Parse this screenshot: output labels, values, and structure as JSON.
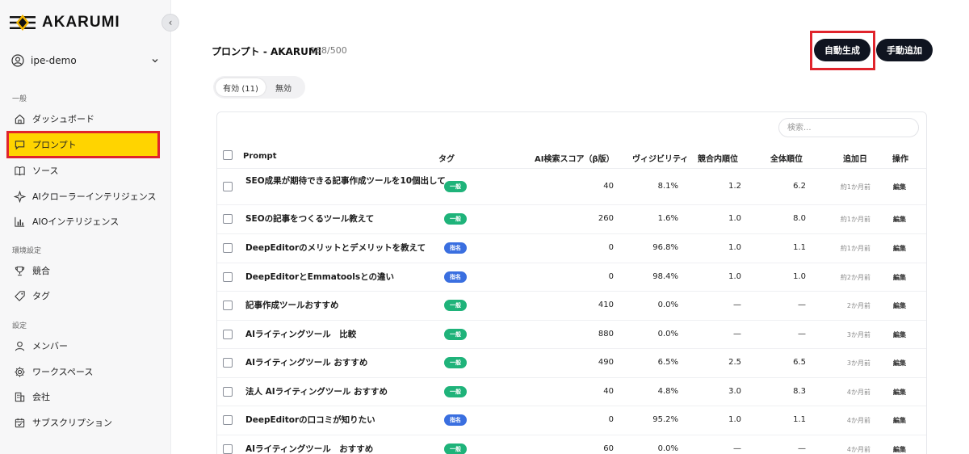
{
  "brand": {
    "name": "AKARUMI"
  },
  "user": {
    "name": "ipe-demo"
  },
  "sidebar": {
    "sections": [
      {
        "label": "一般"
      },
      {
        "label": "環境設定"
      },
      {
        "label": "設定"
      }
    ],
    "items": [
      {
        "label": "ダッシュボード",
        "icon": "home-icon"
      },
      {
        "label": "プロンプト",
        "icon": "chat-icon",
        "active": true
      },
      {
        "label": "ソース",
        "icon": "book-icon"
      },
      {
        "label": "AIクローラーインテリジェンス",
        "icon": "sparkle-icon"
      },
      {
        "label": "AIOインテリジェンス",
        "icon": "bar-chart-icon"
      },
      {
        "label": "競合",
        "icon": "trophy-icon"
      },
      {
        "label": "タグ",
        "icon": "tag-icon"
      },
      {
        "label": "メンバー",
        "icon": "user-icon"
      },
      {
        "label": "ワークスペース",
        "icon": "gear-icon"
      },
      {
        "label": "会社",
        "icon": "building-icon"
      },
      {
        "label": "サブスクリプション",
        "icon": "calendar-icon"
      }
    ]
  },
  "header": {
    "title": "プロンプト - AKARUMI",
    "count": "168/500",
    "auto_generate": "自動生成",
    "manual_add": "手動追加"
  },
  "tabs": [
    {
      "label": "有効 (11)",
      "active": true
    },
    {
      "label": "無効",
      "active": false
    }
  ],
  "search": {
    "placeholder": "検索..."
  },
  "table": {
    "columns": [
      "Prompt",
      "タグ",
      "AI検索スコア（β版）",
      "ヴィジビリティ",
      "競合内順位",
      "全体順位",
      "追加日",
      "操作"
    ],
    "rows": [
      {
        "prompt": "SEO成果が期待できる記事作成ツールを10個出して",
        "tag": "一般",
        "score": "40",
        "visibility": "8.1%",
        "comp_rank": "1.2",
        "overall_rank": "6.2",
        "date": "約1か月前",
        "action": "編集"
      },
      {
        "prompt": "SEOの記事をつくるツール教えて",
        "tag": "一般",
        "score": "260",
        "visibility": "1.6%",
        "comp_rank": "1.0",
        "overall_rank": "8.0",
        "date": "約1か月前",
        "action": "編集"
      },
      {
        "prompt": "DeepEditorのメリットとデメリットを教えて",
        "tag": "指名",
        "score": "0",
        "visibility": "96.8%",
        "comp_rank": "1.0",
        "overall_rank": "1.1",
        "date": "約1か月前",
        "action": "編集"
      },
      {
        "prompt": "DeepEditorとEmmatoolsとの違い",
        "tag": "指名",
        "score": "0",
        "visibility": "98.4%",
        "comp_rank": "1.0",
        "overall_rank": "1.0",
        "date": "約2か月前",
        "action": "編集"
      },
      {
        "prompt": "記事作成ツールおすすめ",
        "tag": "一般",
        "score": "410",
        "visibility": "0.0%",
        "comp_rank": "—",
        "overall_rank": "—",
        "date": "2か月前",
        "action": "編集"
      },
      {
        "prompt": "AIライティングツール　比較",
        "tag": "一般",
        "score": "880",
        "visibility": "0.0%",
        "comp_rank": "—",
        "overall_rank": "—",
        "date": "3か月前",
        "action": "編集"
      },
      {
        "prompt": "AIライティングツール おすすめ",
        "tag": "一般",
        "score": "490",
        "visibility": "6.5%",
        "comp_rank": "2.5",
        "overall_rank": "6.5",
        "date": "3か月前",
        "action": "編集"
      },
      {
        "prompt": "法人 AIライティングツール おすすめ",
        "tag": "一般",
        "score": "40",
        "visibility": "4.8%",
        "comp_rank": "3.0",
        "overall_rank": "8.3",
        "date": "4か月前",
        "action": "編集"
      },
      {
        "prompt": "DeepEditorの口コミが知りたい",
        "tag": "指名",
        "score": "0",
        "visibility": "95.2%",
        "comp_rank": "1.0",
        "overall_rank": "1.1",
        "date": "4か月前",
        "action": "編集"
      },
      {
        "prompt": "AIライティングツール　おすすめ",
        "tag": "一般",
        "score": "60",
        "visibility": "0.0%",
        "comp_rank": "—",
        "overall_rank": "—",
        "date": "4か月前",
        "action": "編集"
      }
    ]
  },
  "colors": {
    "tag_general": "#1fb37a",
    "tag_named": "#3a6fe0",
    "accent_yellow": "#ffd400",
    "highlight_red": "#e0242c",
    "button_dark": "#0f1420"
  }
}
